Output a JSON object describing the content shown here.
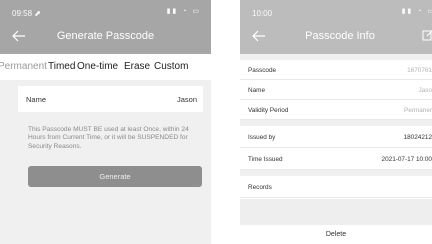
{
  "left_screen": {
    "status": {
      "time": "09:58 ⬈",
      "icons": "▮▮ ◔ ▭"
    },
    "title": "Generate Passcode",
    "tabs": [
      {
        "label": "Permanent",
        "active": false
      },
      {
        "label": "Timed",
        "active": true
      },
      {
        "label": "One-time",
        "active": true
      },
      {
        "label": "Erase",
        "active": true
      },
      {
        "label": "Custom",
        "active": true
      }
    ],
    "name_row": {
      "label": "Name",
      "value": "Jason"
    },
    "notice": "This Passcode MUST BE used at least Once, within 24 Hours from Current Time, or it will be SUSPENDED for Security Reasons.",
    "generate_label": "Generate"
  },
  "right_screen": {
    "status": {
      "time": "10:00",
      "icons": "▮▮ ◔ ▭"
    },
    "title": "Passcode Info",
    "rows": [
      {
        "label": "Passcode",
        "value": "1670761",
        "muted": true
      },
      {
        "label": "Name",
        "value": "Jaso",
        "muted": true
      },
      {
        "label": "Validity Period",
        "value": "Permaner",
        "muted": true
      },
      {
        "label": "Issued by",
        "value": "18024212",
        "muted": false
      },
      {
        "label": "Time Issued",
        "value": "2021-07-17 10:00",
        "muted": false
      },
      {
        "label": "Records",
        "value": "",
        "muted": false
      }
    ],
    "delete_label": "Delete"
  }
}
